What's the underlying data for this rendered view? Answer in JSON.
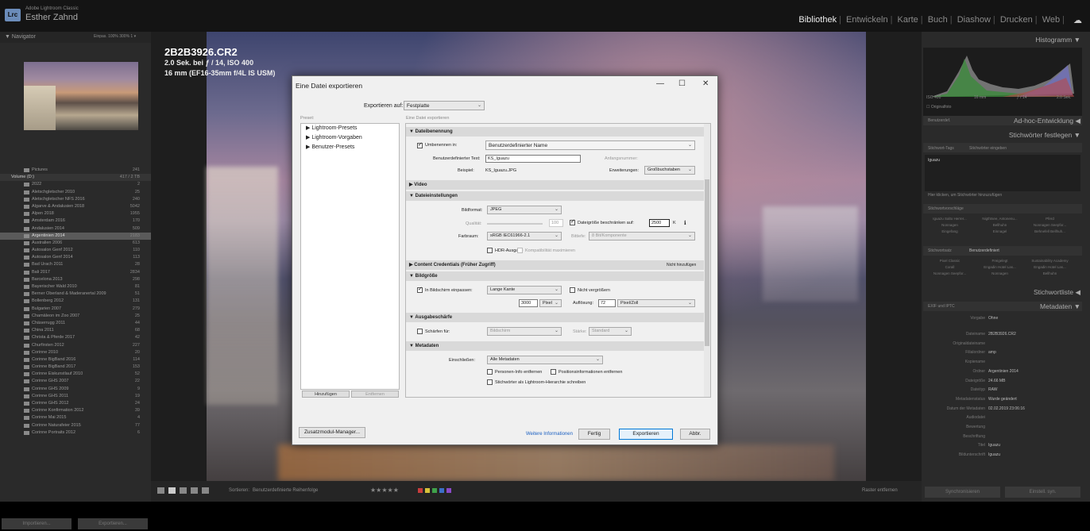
{
  "topbar": {
    "app_name": "Adobe Lightroom Classic",
    "logo": "Lrc",
    "user": "Esther Zahnd",
    "modules": [
      "Bibliothek",
      "Entwickeln",
      "Karte",
      "Buch",
      "Diashow",
      "Drucken",
      "Web"
    ],
    "active_module": "Bibliothek",
    "cloud_icon": "cloud-icon"
  },
  "left_panel": {
    "navigator_title": "Navigator",
    "navigator_zoom": "Einpas. 100% 300% 1 ▾",
    "folders": [
      {
        "name": "Pictures",
        "count": "241",
        "type": "folder"
      },
      {
        "name": "Volume (D:)",
        "count": "417 / 2 TB",
        "type": "volume"
      },
      {
        "name": "2022",
        "count": "2"
      },
      {
        "name": "Aletschgletscher 2010",
        "count": "25"
      },
      {
        "name": "Aletschgletscher NFS 2016",
        "count": "240"
      },
      {
        "name": "Algarve & Andalusien 2018",
        "count": "5042"
      },
      {
        "name": "Alpen 2018",
        "count": "1955"
      },
      {
        "name": "Amsterdam 2016",
        "count": "170"
      },
      {
        "name": "Andalusien 2014",
        "count": "509"
      },
      {
        "name": "Argentinien 2014",
        "count": "2183",
        "selected": true
      },
      {
        "name": "Australien 2006",
        "count": "613"
      },
      {
        "name": "Autosalon Genf 2012",
        "count": "110"
      },
      {
        "name": "Autosalon Genf 2014",
        "count": "113"
      },
      {
        "name": "Bad Urach 2011",
        "count": "28"
      },
      {
        "name": "Bali 2017",
        "count": "2834"
      },
      {
        "name": "Barcelona 2013",
        "count": "298"
      },
      {
        "name": "Bayerischer Wald 2010",
        "count": "81"
      },
      {
        "name": "Berner Oberland & Maderanertal 2009",
        "count": "51"
      },
      {
        "name": "Bollenberg 2012",
        "count": "131"
      },
      {
        "name": "Bulgarien 2007",
        "count": "279"
      },
      {
        "name": "Chamäleon im Zoo 2007",
        "count": "25"
      },
      {
        "name": "Chäserrugg 2011",
        "count": "44"
      },
      {
        "name": "China 2011",
        "count": "68"
      },
      {
        "name": "Christa & Pferde 2017",
        "count": "42"
      },
      {
        "name": "Churfirsten 2012",
        "count": "227"
      },
      {
        "name": "Corinne 2010",
        "count": "20"
      },
      {
        "name": "Corinne BigBand 2016",
        "count": "114"
      },
      {
        "name": "Corinne BigBand 2017",
        "count": "153"
      },
      {
        "name": "Corinne Eiskunstlauf 2010",
        "count": "52"
      },
      {
        "name": "Corinne GHS 2007",
        "count": "22"
      },
      {
        "name": "Corinne GHS 2009",
        "count": "9"
      },
      {
        "name": "Corinne GHS 2011",
        "count": "19"
      },
      {
        "name": "Corinne GHS 2012",
        "count": "24"
      },
      {
        "name": "Corinne Konfirmation 2012",
        "count": "39"
      },
      {
        "name": "Corinne Mai 2015",
        "count": "4"
      },
      {
        "name": "Corinne Naturafeier 2015",
        "count": "77"
      },
      {
        "name": "Corinne Portraits 2012",
        "count": "6"
      }
    ],
    "import_button": "Importieren...",
    "export_button": "Exportieren..."
  },
  "center": {
    "filename": "2B2B3926.CR2",
    "exposure": "2.0 Sek. bei ƒ / 14, ISO 400",
    "lens": "16 mm (EF16-35mm f/4L IS USM)"
  },
  "right_panel": {
    "histogram_title": "Histogramm",
    "histo_readout": [
      "ISO 400",
      "16 mm",
      "ƒ / 14",
      "2.0 Sek."
    ],
    "original_photo": "Originalfoto",
    "quick_develop_title": "Ad-hoc-Entwicklung",
    "quick_develop_preset": "Benutzerdef.",
    "keywording_title": "Stichwörter festlegen",
    "keyword_tags_label": "Stichwort-Tags",
    "keyword_tags_value": "Stichwörter eingeben",
    "keyword_text": "Iguazu",
    "keyword_hint": "Hier klicken, um Stichwörter hinzuzufügen",
    "keyword_suggestions_label": "Stichwortvorschläge",
    "keyword_suggestions": [
      "Iguazu Salto Herrer...",
      "Nigthtsee, Antonenu...",
      "Pferd",
      "Nonnagen",
      "Bellhuhn",
      "Nonnagen Seepfor...",
      "Eingefang",
      "Einnagel",
      "Behnefell Bellhuh..."
    ],
    "keyword_set_label": "Stichwortsatz",
    "keyword_set_value": "Benutzerdefiniert",
    "keyword_set": [
      "Pixel Classic",
      "Freigelegt",
      "Sustainability Academy",
      "Corall",
      "Engadin Hotel Las...",
      "Engadin Hotel Las...",
      "Nonnagen Seepfor...",
      "Nonnagen",
      "Bellhuhn"
    ],
    "keyword_list_title": "Stichwortliste",
    "metadata_title": "Metadaten",
    "metadata_preset_dropdown": "EXIF und IPTC",
    "metadata_preset_label": "Vorgabe",
    "metadata_preset_value": "Ohne",
    "metadata": [
      {
        "label": "Dateiname",
        "value": "2B2B3926.CR2"
      },
      {
        "label": "Originaldateiname",
        "value": ""
      },
      {
        "label": "Filialordner",
        "value": "amp"
      },
      {
        "label": "Kopiename",
        "value": ""
      },
      {
        "label": "Ordner",
        "value": "Argentinien 2014"
      },
      {
        "label": "Dateigröße",
        "value": "24.66 MB"
      },
      {
        "label": "Dateityp",
        "value": "RAW"
      },
      {
        "label": "Metadatenstatus",
        "value": "Wurde geändert"
      },
      {
        "label": "Datum der Metadaten",
        "value": "02.02.2019 23:06:16"
      },
      {
        "label": "Audiodatei",
        "value": ""
      },
      {
        "label": "Bewertung",
        "value": ""
      },
      {
        "label": "Beschriftung",
        "value": ""
      },
      {
        "label": "Titel",
        "value": "Iguazu"
      },
      {
        "label": "Bildunterschrift",
        "value": "Iguazu"
      }
    ],
    "sync_meta_button": "Synchronisieren",
    "sync_settings_button": "Einstell. syn."
  },
  "filmstrip": {
    "sort_label": "Sortieren:",
    "sort_value": "Benutzerdefinierte Reihenfolge",
    "stars": "★★★★★",
    "label_colors": [
      "#c83c3c",
      "#d6c23a",
      "#3fa24a",
      "#3b6fc8",
      "#8a4ac8"
    ],
    "filter_label": "Raster entfernen"
  },
  "dialog": {
    "title": "Eine Datei exportieren",
    "export_to_label": "Exportieren auf:",
    "export_to_value": "Festplatte",
    "preset_label": "Preset:",
    "export_one_file": "Eine Datei exportieren",
    "presets": [
      "Lightroom-Presets",
      "Lightroom-Vorgaben",
      "Benutzer-Presets"
    ],
    "add_button": "Hinzufügen",
    "remove_button": "Entfernen",
    "sections": {
      "file_naming": "Dateibenennung",
      "video": "Video",
      "file_settings": "Dateieinstellungen",
      "content_credentials": "Content Credentials (Früher Zugriff)",
      "content_credentials_status": "Nicht hinzufügen",
      "image_size": "Bildgröße",
      "sharpening": "Ausgabeschärfe",
      "metadata": "Metadaten"
    },
    "naming": {
      "rename_label": "Umbenennen in:",
      "rename_value": "Benutzerdefinierter Name",
      "custom_text_label": "Benutzerdefinierter Text:",
      "custom_text_value": "KS_Iguazu",
      "start_number_label": "Anfangsnummer:",
      "example_label": "Beispiel:",
      "example_value": "KS_Iguazu.JPG",
      "extensions_label": "Erweiterungen:",
      "extensions_value": "Großbuchstaben"
    },
    "file_settings": {
      "format_label": "Bildformat:",
      "format_value": "JPEG",
      "quality_label": "Qualität:",
      "quality_value": "100",
      "limit_label": "Dateigröße beschränken auf:",
      "limit_value": "2500",
      "limit_unit": "K",
      "colorspace_label": "Farbraum:",
      "colorspace_value": "sRGB IEC61966-2.1",
      "bitdepth_label": "Bittiefe:",
      "bitdepth_value": "8 Bit/Komponente",
      "hdr_label": "HDR-Ausgabe",
      "compat_label": "Kompatibilität maximieren"
    },
    "image_size": {
      "fit_label": "In Bildschirm einpassen:",
      "fit_value": "Lange Kante",
      "no_enlarge_label": "Nicht vergrößern",
      "size_value": "3000",
      "size_unit": "Pixel",
      "resolution_label": "Auflösung:",
      "resolution_value": "72",
      "resolution_unit": "Pixel/Zoll"
    },
    "sharpening": {
      "sharpen_label": "Schärfen für:",
      "sharpen_value": "Bildschirm",
      "amount_label": "Stärke:",
      "amount_value": "Standard"
    },
    "metadata": {
      "include_label": "Einschließen:",
      "include_value": "Alle Metadaten",
      "remove_person": "Personen-Info entfernen",
      "remove_location": "Positionsinformationen entfernen",
      "hierarchy": "Stichwörter als Lightroom-Hierarchie schreiben"
    },
    "plugin_manager_button": "Zusatzmodul-Manager...",
    "more_info_link": "Weitere Informationen",
    "done_button": "Fertig",
    "export_button": "Exportieren",
    "cancel_button": "Abbr."
  }
}
